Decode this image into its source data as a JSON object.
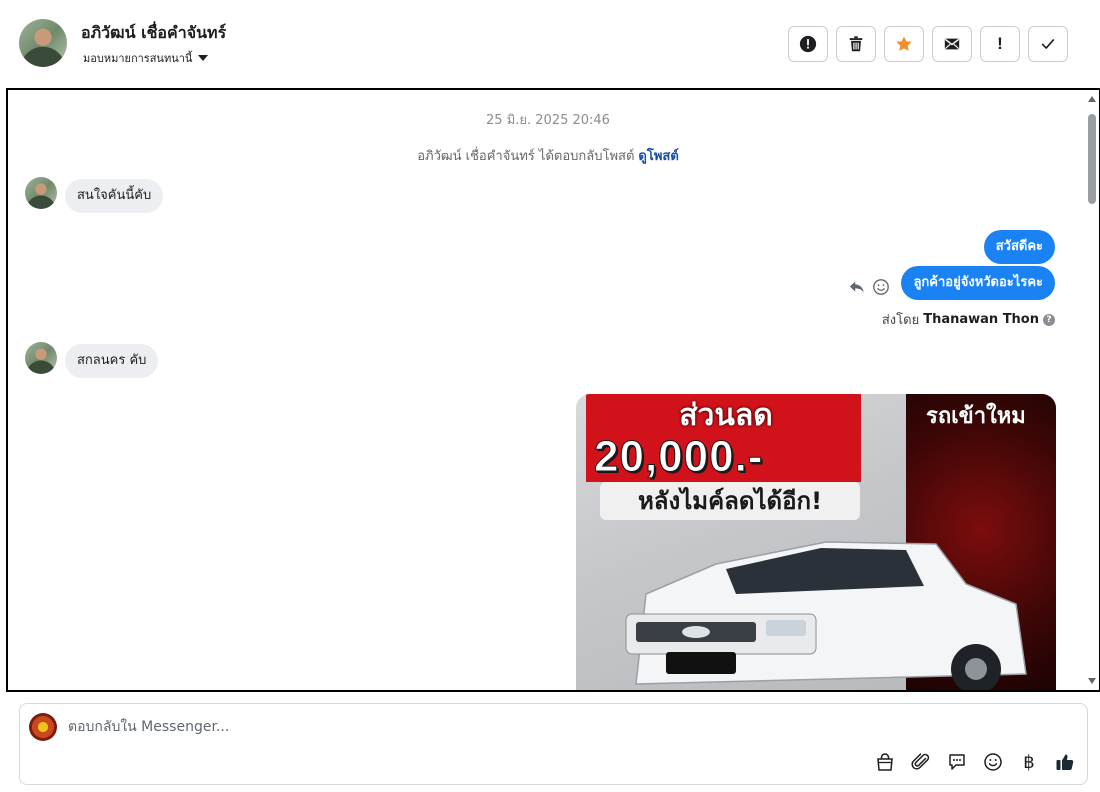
{
  "contact": {
    "name": "อภิวัฒน์ เชื่อคำจันทร์",
    "assign_label": "มอบหมายการสนทนานี้"
  },
  "toolbar": {
    "buttons": [
      "report-icon",
      "trash-icon",
      "star-icon",
      "envelope-icon",
      "exclamation-icon",
      "check-icon"
    ],
    "exclamation_glyph": "!"
  },
  "conversation": {
    "timestamp": "25 มิ.ย. 2025 20:46",
    "system_message": "อภิวัฒน์ เชื่อคำจันทร์ ได้ตอบกลับโพสต์",
    "system_link": "ดูโพสต์",
    "messages": [
      {
        "from": "customer",
        "text": "สนใจคันนี้คับ"
      },
      {
        "from": "page",
        "text": "สวัสดีคะ"
      },
      {
        "from": "page",
        "text": "ลูกค้าอยู่จังหวัดอะไรคะ"
      },
      {
        "from": "customer",
        "text": "สกลนคร คับ"
      }
    ],
    "sent_by_label": "ส่งโดย",
    "sent_by_agent": "Thanawan Thon",
    "help_glyph": "?"
  },
  "promo_image": {
    "headline": "ส่วนลด",
    "amount": "20,000.-",
    "subline": "หลังไมค์ลดได้อีก!",
    "corner_text": "รถเข้าใหม"
  },
  "composer": {
    "placeholder": "ตอบกลับใน Messenger...",
    "tools": [
      "shop-bag-icon",
      "paperclip-icon",
      "saved-reply-icon",
      "emoji-icon",
      "baht-icon",
      "thumbs-up-icon"
    ],
    "baht_glyph": "฿"
  },
  "colors": {
    "accent": "#1a82f2",
    "star": "#f0922b",
    "link": "#1a4fa3",
    "thumb": "#1c2b33"
  }
}
